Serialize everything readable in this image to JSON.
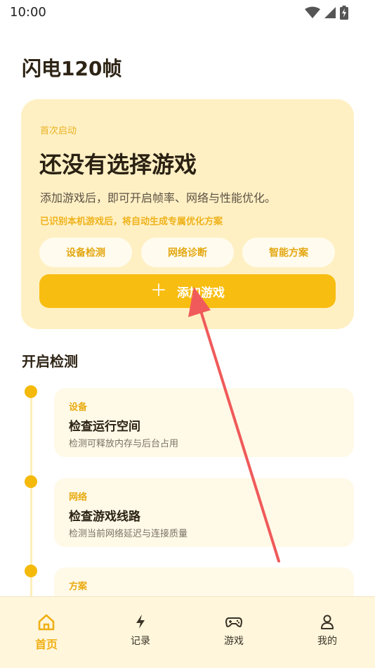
{
  "status_bar": {
    "time": "10:00",
    "icons": [
      "wifi-icon",
      "signal-icon",
      "battery-charging-icon"
    ]
  },
  "app": {
    "title": "闪电120帧"
  },
  "hero": {
    "eyebrow": "首次启动",
    "heading": "还没有选择游戏",
    "description": "添加游戏后，即可开启帧率、网络与性能优化。",
    "note": "已识别本机游戏后，将自动生成专属优化方案",
    "chips": [
      "设备检测",
      "网络诊断",
      "智能方案"
    ],
    "primary_button": "添加游戏"
  },
  "checks": {
    "title": "开启检测",
    "steps": [
      {
        "tag": "设备",
        "title": "检查运行空间",
        "desc": "检测可释放内存与后台占用"
      },
      {
        "tag": "网络",
        "title": "检查游戏线路",
        "desc": "检测当前网络延迟与连接质量"
      },
      {
        "tag": "方案",
        "title": "",
        "desc": ""
      }
    ]
  },
  "nav": {
    "items": [
      {
        "label": "首页",
        "icon": "home-icon",
        "active": true
      },
      {
        "label": "记录",
        "icon": "lightning-icon"
      },
      {
        "label": "游戏",
        "icon": "gamepad-icon"
      },
      {
        "label": "我的",
        "icon": "user-icon"
      }
    ]
  },
  "colors": {
    "accent": "#f8bd11",
    "card_bg": "#fff0c4",
    "arrow": "#f05a5a"
  }
}
